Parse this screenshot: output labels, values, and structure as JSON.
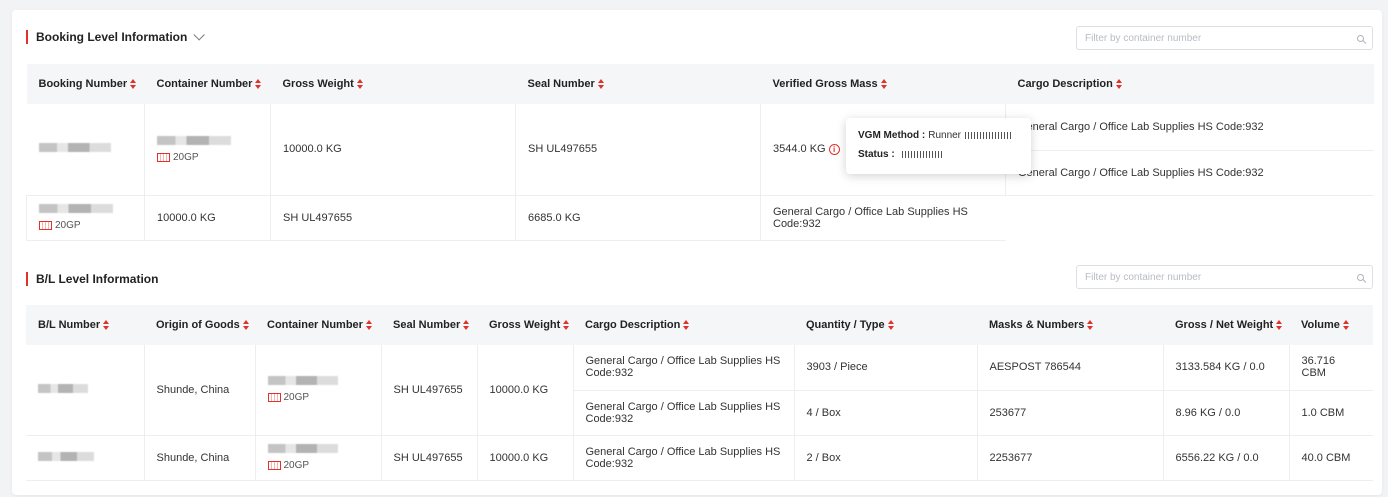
{
  "booking_section": {
    "title": "Booking Level Information",
    "filter_placeholder": "Filter by container number",
    "columns": [
      "Booking Number",
      "Container Number",
      "Gross Weight",
      "Seal Number",
      "Verified Gross Mass",
      "Cargo Description"
    ],
    "rows": [
      {
        "container_type": "20GP",
        "gross_weight": "10000.0 KG",
        "seal_number": "SH UL497655",
        "vgm": "3544.0 KG",
        "cargo": "General Cargo / Office Lab Supplies HS Code:932"
      },
      {
        "cargo": "General Cargo / Office Lab Supplies HS Code:932"
      },
      {
        "container_type": "20GP",
        "gross_weight": "10000.0 KG",
        "seal_number": "SH UL497655",
        "vgm": "6685.0 KG",
        "cargo": "General Cargo / Office Lab Supplies HS Code:932"
      }
    ],
    "tooltip": {
      "vgm_method_label": "VGM Method :",
      "vgm_method_value": "Runner",
      "status_label": "Status :"
    }
  },
  "bl_section": {
    "title": "B/L Level Information",
    "filter_placeholder": "Filter by container number",
    "columns": [
      "B/L Number",
      "Origin of Goods",
      "Container Number",
      "Seal Number",
      "Gross Weight",
      "Cargo Description",
      "Quantity / Type",
      "Masks & Numbers",
      "Gross / Net Weight",
      "Volume"
    ],
    "rows": [
      {
        "origin": "Shunde, China",
        "container_type": "20GP",
        "seal_number": "SH UL497655",
        "gross_weight": "10000.0 KG",
        "cargo": "General Cargo / Office Lab Supplies HS Code:932",
        "quantity": "3903 / Piece",
        "marks": "AESPOST 786544",
        "gross_net": "3133.584 KG / 0.0",
        "volume": "36.716 CBM"
      },
      {
        "cargo": "General Cargo / Office Lab Supplies HS Code:932",
        "quantity": "4 / Box",
        "marks": "253677",
        "gross_net": "8.96 KG / 0.0",
        "volume": "1.0 CBM"
      },
      {
        "origin": "Shunde, China",
        "container_type": "20GP",
        "seal_number": "SH UL497655",
        "gross_weight": "10000.0 KG",
        "cargo": "General Cargo / Office Lab Supplies HS Code:932",
        "quantity": "2 / Box",
        "marks": "2253677",
        "gross_net": "6556.22 KG / 0.0",
        "volume": "40.0 CBM"
      }
    ]
  },
  "colors": {
    "accent": "#e0322b",
    "header_bg": "#f5f6f8"
  }
}
